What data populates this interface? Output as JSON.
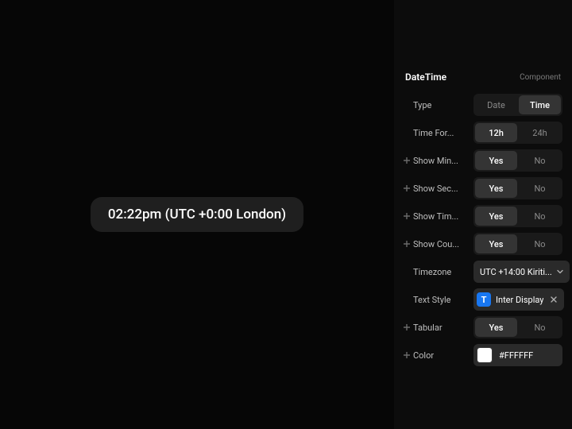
{
  "preview": {
    "text": "02:22pm (UTC +0:00 London)"
  },
  "panel": {
    "title": "DateTime",
    "subtitle": "Component"
  },
  "rows": {
    "type": {
      "label": "Type",
      "optA": "Date",
      "optB": "Time",
      "selected": "B"
    },
    "timeFormat": {
      "label": "Time For...",
      "optA": "12h",
      "optB": "24h",
      "selected": "A"
    },
    "showMinutes": {
      "label": "Show Min...",
      "optA": "Yes",
      "optB": "No",
      "selected": "A"
    },
    "showSeconds": {
      "label": "Show Sec...",
      "optA": "Yes",
      "optB": "No",
      "selected": "A"
    },
    "showTimezone": {
      "label": "Show Tim...",
      "optA": "Yes",
      "optB": "No",
      "selected": "A"
    },
    "showCountry": {
      "label": "Show Cou...",
      "optA": "Yes",
      "optB": "No",
      "selected": "A"
    },
    "timezone": {
      "label": "Timezone",
      "value": "UTC +14:00 Kiriti..."
    },
    "textStyle": {
      "label": "Text Style",
      "badge": "T",
      "value": "Inter Display"
    },
    "tabular": {
      "label": "Tabular",
      "optA": "Yes",
      "optB": "No",
      "selected": "A"
    },
    "color": {
      "label": "Color",
      "hex": "#FFFFFF",
      "swatch": "#FFFFFF"
    }
  }
}
